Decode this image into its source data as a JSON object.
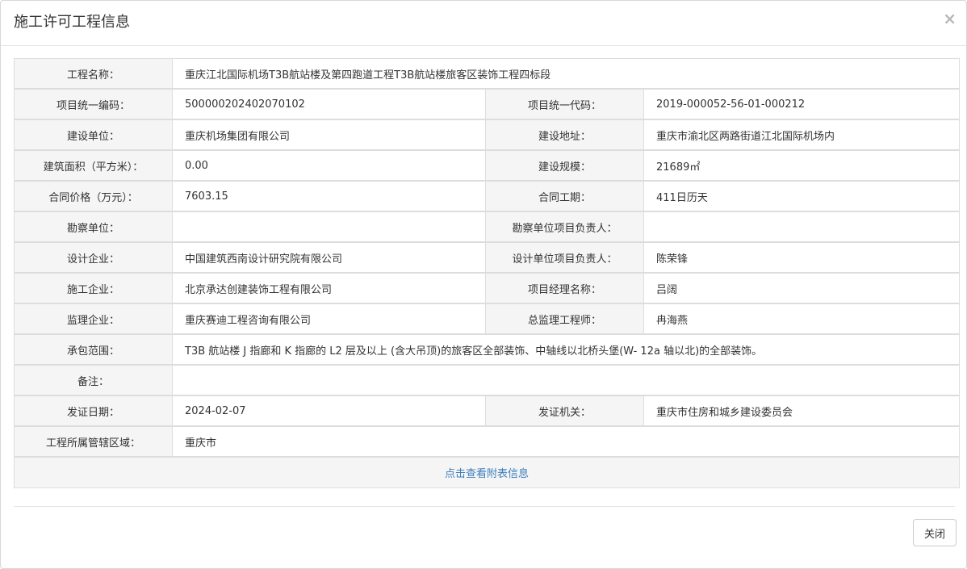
{
  "modal": {
    "title": "施工许可工程信息",
    "close_symbol": "×",
    "close_button_label": "关闭",
    "link_label": "点击查看附表信息"
  },
  "rows": [
    {
      "label": "工程名称：",
      "value": "重庆江北国际机场T3B航站楼及第四跑道工程T3B航站楼旅客区装饰工程四标段"
    },
    {
      "label": "项目统一编码：",
      "value": "500000202402070102",
      "label2": "项目统一代码：",
      "value2": "2019-000052-56-01-000212"
    },
    {
      "label": "建设单位：",
      "value": "重庆机场集团有限公司",
      "label2": "建设地址：",
      "value2": "重庆市渝北区两路街道江北国际机场内"
    },
    {
      "label": "建筑面积（平方米）：",
      "value": "0.00",
      "label2": "建设规模：",
      "value2": "21689㎡"
    },
    {
      "label": "合同价格（万元）：",
      "value": "7603.15",
      "label2": "合同工期：",
      "value2": "411日历天"
    },
    {
      "label": "勘察单位：",
      "value": "",
      "label2": "勘察单位项目负责人：",
      "value2": ""
    },
    {
      "label": "设计企业：",
      "value": "中国建筑西南设计研究院有限公司",
      "label2": "设计单位项目负责人：",
      "value2": "陈荣锋"
    },
    {
      "label": "施工企业：",
      "value": "北京承达创建装饰工程有限公司",
      "label2": "项目经理名称：",
      "value2": "吕阔"
    },
    {
      "label": "监理企业：",
      "value": "重庆赛迪工程咨询有限公司",
      "label2": "总监理工程师：",
      "value2": "冉海燕"
    },
    {
      "label": "承包范围：",
      "value": "T3B 航站楼 J 指廊和 K 指廊的 L2 层及以上 (含大吊顶)的旅客区全部装饰、中轴线以北桥头堡(W- 12a 轴以北)的全部装饰。"
    },
    {
      "label": "备注：",
      "value": ""
    },
    {
      "label": "发证日期：",
      "value": "2024-02-07",
      "label2": "发证机关：",
      "value2": "重庆市住房和城乡建设委员会"
    },
    {
      "label": "工程所属管辖区域：",
      "value": "重庆市"
    }
  ]
}
